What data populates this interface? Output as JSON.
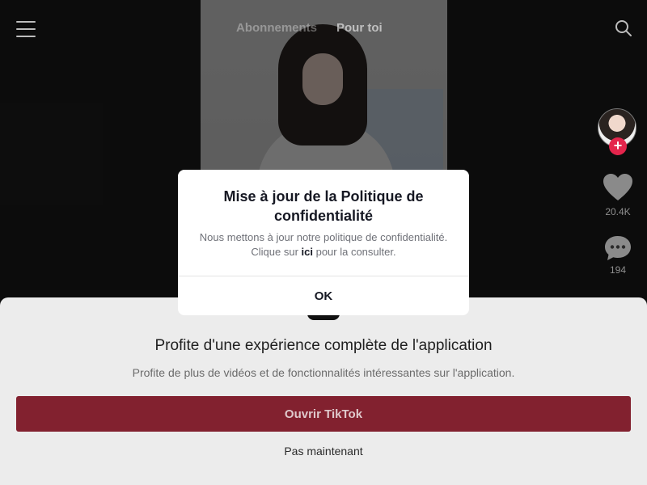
{
  "feed": {
    "tabs": [
      {
        "label": "Abonnements",
        "active": false
      },
      {
        "label": "Pour toi",
        "active": true
      }
    ],
    "icons": {
      "menu": "hamburger-menu-icon",
      "search": "search-icon",
      "like": "heart-icon",
      "comment": "comment-icon",
      "follow": "plus-icon"
    },
    "creator": {
      "follow_symbol": "+"
    },
    "stats": {
      "likes": "20.4K",
      "comments": "194"
    }
  },
  "modal": {
    "title": "Mise à jour de la Politique de confidentialité",
    "body_before": "Nous mettons à jour notre politique de confidentialité. Clique sur ",
    "body_link": "ici",
    "body_after": " pour la consulter.",
    "ok_label": "OK"
  },
  "bottom_sheet": {
    "title": "Profite d'une expérience complète de l'application",
    "subtitle": "Profite de plus de vidéos et de fonctionnalités intéressantes sur l'application.",
    "open_label": "Ouvrir TikTok",
    "dismiss_label": "Pas maintenant"
  },
  "colors": {
    "accent": "#e4254c",
    "open_button": "#82212f",
    "sheet_background": "#ececec",
    "modal_background": "#ffffff"
  }
}
